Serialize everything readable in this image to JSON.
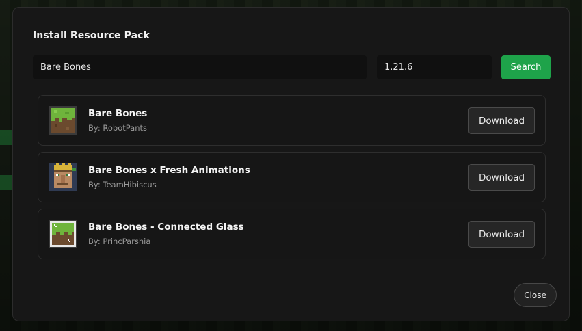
{
  "dialog": {
    "title": "Install Resource Pack",
    "search_value": "Bare Bones",
    "version_value": "1.21.6",
    "search_button": "Search",
    "close_button": "Close"
  },
  "results": [
    {
      "name": "Bare Bones",
      "author": "By: RobotPants",
      "icon": "grass-block-icon",
      "download": "Download"
    },
    {
      "name": "Bare Bones x Fresh Animations",
      "author": "By: TeamHibiscus",
      "icon": "villager-face-icon",
      "download": "Download"
    },
    {
      "name": "Bare Bones - Connected Glass",
      "author": "By: PrincParshia",
      "icon": "glass-grass-block-icon",
      "download": "Download"
    }
  ],
  "colors": {
    "accent": "#1ea34a",
    "dialog_bg": "#171717",
    "card_border": "#2e2e2e"
  }
}
